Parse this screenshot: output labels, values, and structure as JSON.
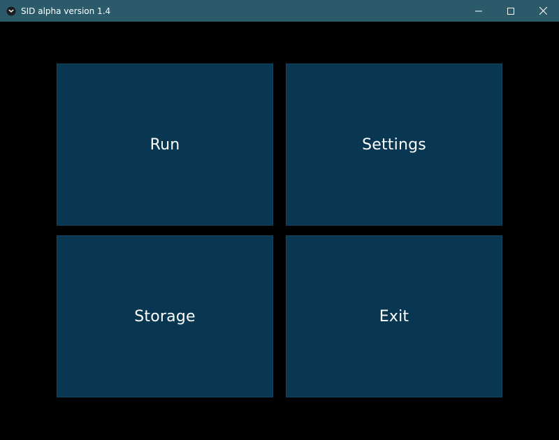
{
  "window": {
    "title": "SID alpha version 1.4",
    "app_icon": "bird-logo-icon",
    "controls": [
      "minimize-icon",
      "maximize-icon",
      "close-icon"
    ]
  },
  "menu": {
    "tiles": [
      {
        "label": "Run"
      },
      {
        "label": "Settings"
      },
      {
        "label": "Storage"
      },
      {
        "label": "Exit"
      }
    ]
  },
  "colors": {
    "titlebar": "#2b5a6a",
    "background": "#000000",
    "tile": "#093752",
    "text": "#ffffff"
  }
}
